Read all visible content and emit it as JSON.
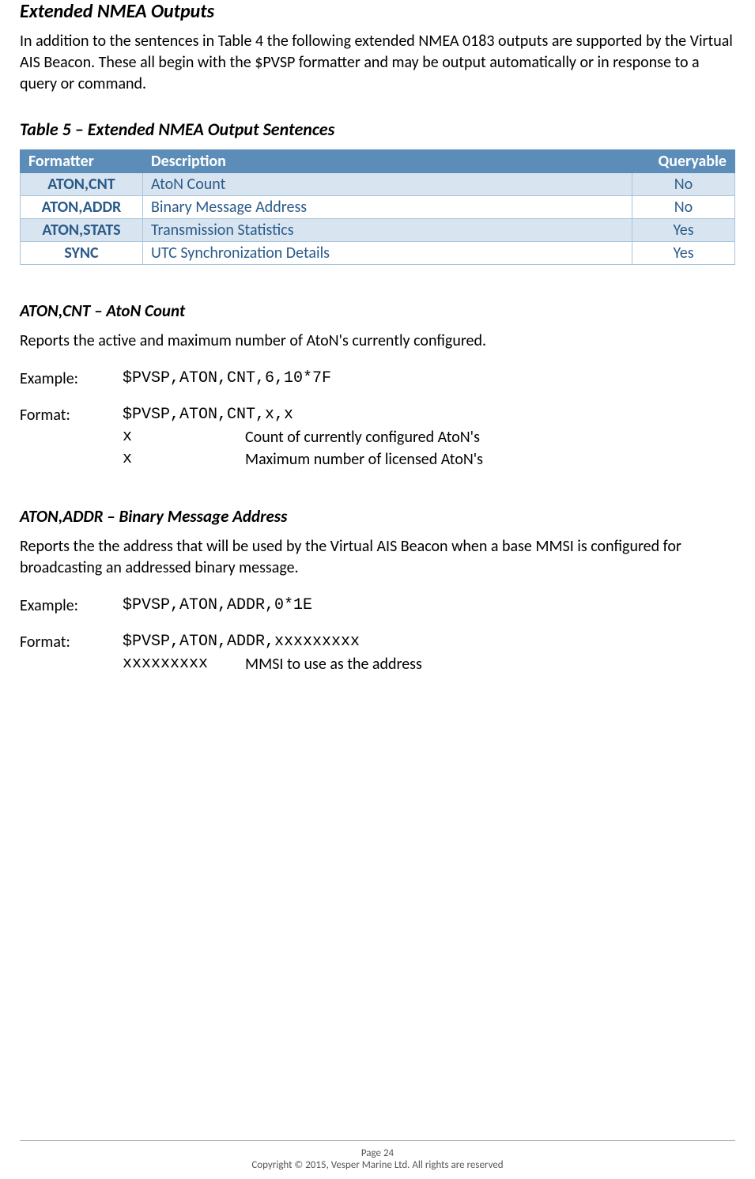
{
  "heading_main": "Extended NMEA Outputs",
  "intro_para": "In addition to the sentences in Table 4 the following extended NMEA 0183 outputs are supported by the Virtual AIS Beacon. These all begin with the $PVSP formatter and may be output automatically or in response to a query or command.",
  "table_caption": "Table 5 – Extended NMEA Output Sentences",
  "table": {
    "headers": {
      "formatter": "Formatter",
      "description": "Description",
      "queryable": "Queryable"
    },
    "rows": [
      {
        "formatter": "ATON,CNT",
        "description": "AtoN Count",
        "queryable": "No"
      },
      {
        "formatter": "ATON,ADDR",
        "description": "Binary Message Address",
        "queryable": "No"
      },
      {
        "formatter": "ATON,STATS",
        "description": "Transmission Statistics",
        "queryable": "Yes"
      },
      {
        "formatter": "SYNC",
        "description": "UTC Synchronization Details",
        "queryable": "Yes"
      }
    ]
  },
  "section1": {
    "heading": "ATON,CNT – AtoN Count",
    "desc": "Reports the active and maximum number of AtoN's currently configured.",
    "example_label": "Example:",
    "example": "$PVSP,ATON,CNT,6,10*7F",
    "format_label": "Format:",
    "format": "$PVSP,ATON,CNT,x,x",
    "params": [
      {
        "key": "x",
        "desc": "Count of currently configured AtoN's"
      },
      {
        "key": "x",
        "desc": "Maximum number of licensed AtoN's"
      }
    ]
  },
  "section2": {
    "heading": "ATON,ADDR –  Binary Message Address",
    "desc": "Reports the the address that will be used by the Virtual AIS Beacon when a base MMSI is configured for broadcasting an addressed binary message.",
    "example_label": "Example:",
    "example": "$PVSP,ATON,ADDR,0*1E",
    "format_label": "Format:",
    "format": "$PVSP,ATON,ADDR,xxxxxxxxx",
    "params": [
      {
        "key": "xxxxxxxxx",
        "desc": "MMSI to use as the address"
      }
    ]
  },
  "footer": {
    "page": "Page 24",
    "copyright": "Copyright © 2015, Vesper Marine Ltd. All rights are reserved"
  }
}
